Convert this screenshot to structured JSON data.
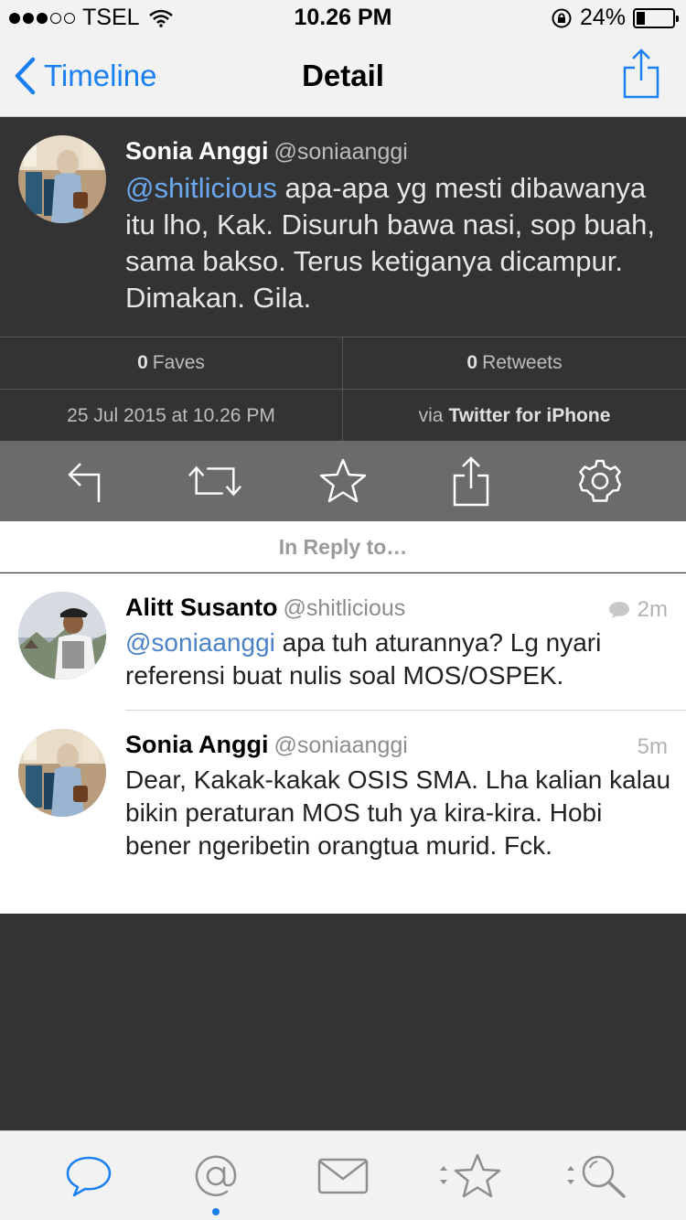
{
  "status_bar": {
    "carrier": "TSEL",
    "time": "10.26 PM",
    "battery": "24%",
    "battery_level": 0.24,
    "signal_bars_filled": 3,
    "signal_bars_total": 5
  },
  "nav": {
    "back_label": "Timeline",
    "title": "Detail",
    "accent_color": "#1a7ff0"
  },
  "main_tweet": {
    "name": "Sonia Anggi",
    "handle": "@soniaanggi",
    "mention": "@shitlicious",
    "text": " apa-apa yg mesti dibawanya itu lho, Kak. Disuruh bawa nasi, sop buah, sama bakso. Terus ketiganya dicampur. Dimakan. Gila."
  },
  "stats": {
    "faves_count": "0",
    "faves_label": "Faves",
    "retweets_count": "0",
    "retweets_label": "Retweets",
    "date": "25 Jul 2015 at 10.26 PM",
    "via_prefix": "via",
    "via_app": "Twitter for iPhone"
  },
  "actions": [
    {
      "icon": "reply-icon"
    },
    {
      "icon": "retweet-icon"
    },
    {
      "icon": "star-icon"
    },
    {
      "icon": "share-icon"
    },
    {
      "icon": "gear-icon"
    }
  ],
  "reply_header": "In Reply to…",
  "replies": [
    {
      "name": "Alitt Susanto",
      "handle": "@shitlicious",
      "time": "2m",
      "has_conversation_icon": true,
      "mention": "@soniaanggi",
      "text": " apa tuh aturannya? Lg nyari referensi buat nulis soal MOS/OSPEK."
    },
    {
      "name": "Sonia Anggi",
      "handle": "@soniaanggi",
      "time": "5m",
      "text": "Dear, Kakak-kakak OSIS SMA. Lha kalian kalau bikin peraturan MOS tuh ya kira-kira. Hobi bener ngeribetin orangtua murid. Fck."
    }
  ],
  "tab_bar": [
    {
      "icon": "timeline-bubble-icon",
      "active": true
    },
    {
      "icon": "mentions-at-icon",
      "has_indicator": true
    },
    {
      "icon": "messages-envelope-icon"
    },
    {
      "icon": "favorites-star-icon"
    },
    {
      "icon": "search-icon"
    }
  ]
}
